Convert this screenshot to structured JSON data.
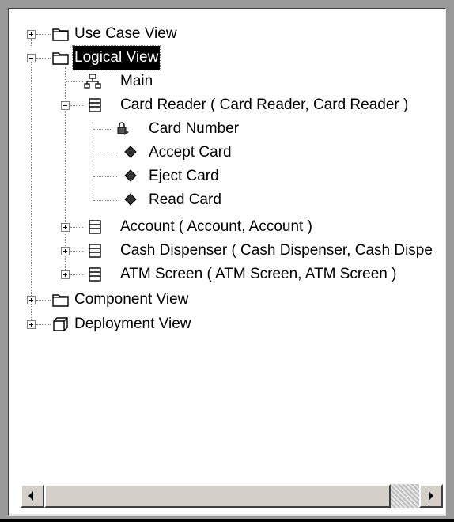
{
  "tree": {
    "use_case_view": "Use Case View",
    "logical_view": "Logical View",
    "main": "Main",
    "card_reader": "Card Reader ( Card Reader, Card Reader )",
    "card_number": "Card Number",
    "accept_card": "Accept Card",
    "eject_card": "Eject Card",
    "read_card": "Read Card",
    "account": "Account ( Account, Account )",
    "cash_dispenser": "Cash Dispenser ( Cash Dispenser, Cash Dispe",
    "atm_screen": "ATM Screen ( ATM Screen, ATM Screen )",
    "component_view": "Component View",
    "deployment_view": "Deployment View"
  },
  "icons": {
    "folder": "folder-icon",
    "diagram": "class-diagram-icon",
    "class": "class-icon",
    "attribute": "attribute-icon",
    "operation": "operation-icon",
    "deployment": "deployment-icon"
  },
  "scrollbar": {
    "orientation": "horizontal",
    "position": 0.95
  }
}
